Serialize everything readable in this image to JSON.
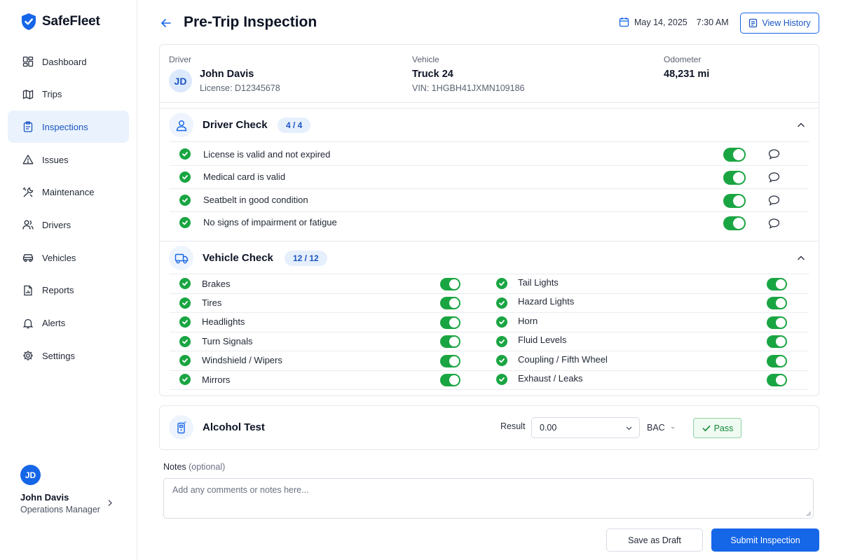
{
  "app": {
    "name": "SafeFleet"
  },
  "sidebar": {
    "items": [
      {
        "label": "Dashboard",
        "icon": "dashboard-icon",
        "active": false
      },
      {
        "label": "Trips",
        "icon": "map-icon",
        "active": false
      },
      {
        "label": "Inspections",
        "icon": "clipboard-icon",
        "active": true
      },
      {
        "label": "Issues",
        "icon": "warning-icon",
        "active": false
      },
      {
        "label": "Maintenance",
        "icon": "tools-icon",
        "active": false
      },
      {
        "label": "Drivers",
        "icon": "users-icon",
        "active": false
      },
      {
        "label": "Vehicles",
        "icon": "car-icon",
        "active": false
      },
      {
        "label": "Reports",
        "icon": "report-icon",
        "active": false
      },
      {
        "label": "Alerts",
        "icon": "bell-icon",
        "active": false
      },
      {
        "label": "Settings",
        "icon": "gear-icon",
        "active": false
      }
    ],
    "user": {
      "initials": "JD",
      "name": "John Davis",
      "role": "Operations Manager"
    }
  },
  "header": {
    "title": "Pre-Trip Inspection",
    "date": "May 14, 2025",
    "time": "7:30 AM",
    "history_button": "View History"
  },
  "info": {
    "driver": {
      "label": "Driver",
      "initials": "JD",
      "name": "John Davis",
      "license": "License: D12345678"
    },
    "vehicle": {
      "label": "Vehicle",
      "name": "Truck 24",
      "vin": "VIN: 1HGBH41JXMN109186"
    },
    "odometer": {
      "label": "Odometer",
      "value": "48,231 mi"
    }
  },
  "driver_check": {
    "title": "Driver Check",
    "badge": "4 / 4",
    "items": [
      {
        "label": "License is valid and not expired",
        "checked": true
      },
      {
        "label": "Medical card is valid",
        "checked": true
      },
      {
        "label": "Seatbelt in good condition",
        "checked": true
      },
      {
        "label": "No signs of impairment or fatigue",
        "checked": true
      }
    ]
  },
  "vehicle_check": {
    "title": "Vehicle Check",
    "badge": "12 / 12",
    "left": [
      {
        "label": "Brakes",
        "checked": true
      },
      {
        "label": "Tires",
        "checked": true
      },
      {
        "label": "Headlights",
        "checked": true
      },
      {
        "label": "Turn Signals",
        "checked": true
      },
      {
        "label": "Windshield / Wipers",
        "checked": true
      },
      {
        "label": "Mirrors",
        "checked": true
      }
    ],
    "right": [
      {
        "label": "Tail Lights",
        "checked": true
      },
      {
        "label": "Hazard Lights",
        "checked": true
      },
      {
        "label": "Horn",
        "checked": true
      },
      {
        "label": "Fluid Levels",
        "checked": true
      },
      {
        "label": "Coupling / Fifth Wheel",
        "checked": true
      },
      {
        "label": "Exhaust / Leaks",
        "checked": true
      }
    ]
  },
  "alcohol_test": {
    "title": "Alcohol Test",
    "result_label": "Result",
    "value": "0.00",
    "unit": "BAC",
    "status": "Pass"
  },
  "notes": {
    "label": "Notes",
    "optional": "(optional)",
    "placeholder": "Add any comments or notes here..."
  },
  "actions": {
    "draft": "Save as Draft",
    "submit": "Submit Inspection"
  },
  "colors": {
    "primary": "#1666e8",
    "success": "#1aa543",
    "active_bg": "#eaf2fd"
  }
}
